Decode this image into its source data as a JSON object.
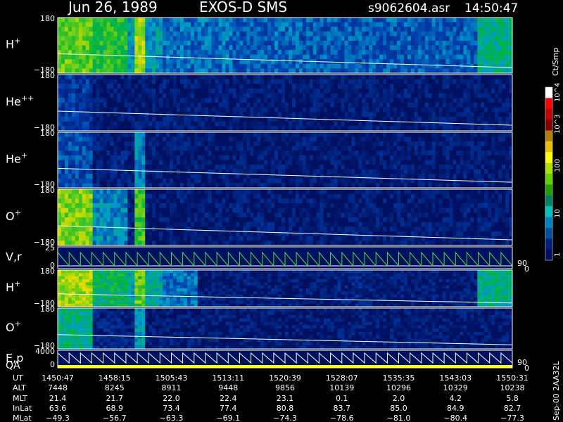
{
  "header": {
    "date": "Jun 26, 1989",
    "instrument": "EXOS-D SMS",
    "file": "s9062604.asr",
    "time": "14:50:47"
  },
  "chart_data": {
    "type": "heatmap",
    "panels": [
      {
        "id": "hplus",
        "label": "H",
        "sup": "+",
        "kind": "spectrogram",
        "ymax": "180",
        "ymin": "−180",
        "intensity": [
          0.8,
          0.7,
          0.45,
          0.35,
          0.35,
          0.3,
          0.32,
          0.3,
          0.3,
          0.3,
          0.3,
          0.3,
          0.55
        ],
        "events": [
          [
            22,
            24,
            0.9
          ]
        ]
      },
      {
        "id": "hepp",
        "label": "He",
        "sup": "++",
        "kind": "spectrogram",
        "ymax": "180",
        "ymin": "−180",
        "intensity": [
          0.2,
          0.05,
          0.05,
          0.05,
          0.05,
          0.05,
          0.05,
          0.05,
          0.05,
          0.05,
          0.05,
          0.05,
          0.05
        ],
        "events": []
      },
      {
        "id": "hep",
        "label": "He",
        "sup": "+",
        "kind": "spectrogram",
        "ymax": "180",
        "ymin": "−180",
        "intensity": [
          0.25,
          0.08,
          0.05,
          0.05,
          0.05,
          0.05,
          0.05,
          0.05,
          0.05,
          0.05,
          0.05,
          0.05,
          0.05
        ],
        "events": [
          [
            22,
            24,
            0.4
          ]
        ]
      },
      {
        "id": "oplus",
        "label": "O",
        "sup": "+",
        "kind": "spectrogram",
        "ymax": "180",
        "ymin": "−180",
        "intensity": [
          0.85,
          0.4,
          0.05,
          0.05,
          0.05,
          0.05,
          0.05,
          0.05,
          0.05,
          0.05,
          0.05,
          0.05,
          0.05
        ],
        "events": [
          [
            22,
            24,
            0.75
          ]
        ]
      },
      {
        "id": "vr",
        "label": "V,r",
        "sup": "",
        "kind": "line",
        "ymax": "25",
        "ymin": "0",
        "right_top": "90",
        "right_bottom": "0"
      },
      {
        "id": "hplus2",
        "label": "H",
        "sup": "+",
        "kind": "spectrogram",
        "ymax": "180",
        "ymin": "−180",
        "intensity": [
          0.9,
          0.6,
          0.5,
          0.35,
          0.05,
          0.05,
          0.05,
          0.05,
          0.1,
          0.05,
          0.05,
          0.05,
          0.55
        ],
        "events": [
          [
            22,
            24,
            0.8
          ]
        ]
      },
      {
        "id": "oplus2",
        "label": "O",
        "sup": "+",
        "kind": "spectrogram",
        "ymax": "180",
        "ymin": "−180",
        "intensity": [
          0.55,
          0.1,
          0.05,
          0.05,
          0.05,
          0.05,
          0.05,
          0.05,
          0.05,
          0.05,
          0.05,
          0.05,
          0.05
        ],
        "events": [
          [
            22,
            24,
            0.45
          ]
        ]
      },
      {
        "id": "ep",
        "label": "E,p",
        "sup": "",
        "label2": "QA",
        "kind": "sweep",
        "ymax": "4000",
        "ymin": "0",
        "right_top": "90",
        "right_bottom": "0"
      }
    ],
    "colorbar": {
      "unit": "Ct/Smp",
      "ticks": [
        "10^4",
        "10^3",
        "100",
        "10",
        "1"
      ],
      "colors": [
        "#ffffff",
        "#ff0000",
        "#c00000",
        "#800000",
        "#b08000",
        "#e8c000",
        "#ffff00",
        "#b0e000",
        "#60d000",
        "#20a000",
        "#008060",
        "#00c0c0",
        "#0080c0",
        "#0050a0",
        "#002080",
        "#001060"
      ]
    },
    "rows": {
      "labels": [
        "UT",
        "ALT",
        "MLT",
        "InLat",
        "MLat"
      ],
      "columns": [
        [
          "1450:47",
          "7448",
          "21.4",
          "63.6",
          "−49.3"
        ],
        [
          "1458:15",
          "8245",
          "21.7",
          "68.9",
          "−56.7"
        ],
        [
          "1505:43",
          "8911",
          "22.0",
          "73.4",
          "−63.3"
        ],
        [
          "1513:11",
          "9448",
          "22.4",
          "77.4",
          "−69.1"
        ],
        [
          "1520:39",
          "9856",
          "23.1",
          "80.8",
          "−74.3"
        ],
        [
          "1528:07",
          "10139",
          "0.1",
          "83.7",
          "−78.6"
        ],
        [
          "1535:35",
          "10296",
          "2.0",
          "85.0",
          "−81.0"
        ],
        [
          "1543:03",
          "10329",
          "4.2",
          "84.9",
          "−80.4"
        ],
        [
          "1550:31",
          "10238",
          "5.8",
          "82.7",
          "−77.3"
        ]
      ]
    },
    "footer_vertical": "Sep-00 2AA32L"
  }
}
